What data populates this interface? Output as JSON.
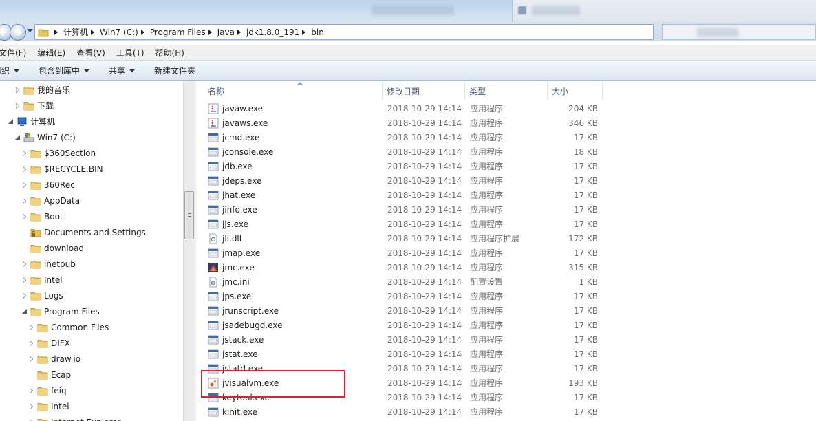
{
  "address": {
    "crumbs": [
      "计算机",
      "Win7 (C:)",
      "Program Files",
      "Java",
      "jdk1.8.0_191",
      "bin"
    ]
  },
  "menu": [
    "文件(F)",
    "编辑(E)",
    "查看(V)",
    "工具(T)",
    "帮助(H)"
  ],
  "commands": {
    "organize": "组织",
    "include_library": "包含到库中",
    "share": "共享",
    "new_folder": "新建文件夹"
  },
  "tree": [
    {
      "label": "我的音乐",
      "indent": 0,
      "icon": "music-folder-icon",
      "toggle": "collapsed"
    },
    {
      "label": "下载",
      "indent": 0,
      "icon": "download-folder-icon",
      "toggle": "collapsed"
    },
    {
      "label": "计算机",
      "indent": -1,
      "icon": "computer-icon",
      "toggle": "expanded"
    },
    {
      "label": "Win7 (C:)",
      "indent": 0,
      "icon": "drive-icon",
      "toggle": "expanded"
    },
    {
      "label": "$360Section",
      "indent": 1,
      "icon": "folder-icon",
      "toggle": "collapsed"
    },
    {
      "label": "$RECYCLE.BIN",
      "indent": 1,
      "icon": "folder-icon",
      "toggle": "collapsed"
    },
    {
      "label": "360Rec",
      "indent": 1,
      "icon": "folder-icon",
      "toggle": "collapsed"
    },
    {
      "label": "AppData",
      "indent": 1,
      "icon": "folder-icon",
      "toggle": "collapsed"
    },
    {
      "label": "Boot",
      "indent": 1,
      "icon": "folder-icon",
      "toggle": "collapsed"
    },
    {
      "label": "Documents and Settings",
      "indent": 1,
      "icon": "locked-folder-icon",
      "toggle": "none"
    },
    {
      "label": "download",
      "indent": 1,
      "icon": "folder-icon",
      "toggle": "none"
    },
    {
      "label": "inetpub",
      "indent": 1,
      "icon": "folder-icon",
      "toggle": "collapsed"
    },
    {
      "label": "Intel",
      "indent": 1,
      "icon": "folder-icon",
      "toggle": "collapsed"
    },
    {
      "label": "Logs",
      "indent": 1,
      "icon": "folder-icon",
      "toggle": "collapsed"
    },
    {
      "label": "Program Files",
      "indent": 1,
      "icon": "folder-icon",
      "toggle": "expanded"
    },
    {
      "label": "Common Files",
      "indent": 2,
      "icon": "folder-icon",
      "toggle": "collapsed"
    },
    {
      "label": "DIFX",
      "indent": 2,
      "icon": "folder-icon",
      "toggle": "collapsed"
    },
    {
      "label": "draw.io",
      "indent": 2,
      "icon": "folder-icon",
      "toggle": "collapsed"
    },
    {
      "label": "Ecap",
      "indent": 2,
      "icon": "folder-icon",
      "toggle": "none"
    },
    {
      "label": "feiq",
      "indent": 2,
      "icon": "folder-icon",
      "toggle": "collapsed"
    },
    {
      "label": "Intel",
      "indent": 2,
      "icon": "folder-icon",
      "toggle": "collapsed"
    },
    {
      "label": "Internet Explorer",
      "indent": 2,
      "icon": "folder-icon",
      "toggle": "collapsed"
    }
  ],
  "columns": {
    "name": "名称",
    "date": "修改日期",
    "type": "类型",
    "size": "大小"
  },
  "files": [
    {
      "name": "javaw.exe",
      "date": "2018-10-29 14:14",
      "type": "应用程序",
      "size": "204 KB",
      "icon": "java-exe-icon"
    },
    {
      "name": "javaws.exe",
      "date": "2018-10-29 14:14",
      "type": "应用程序",
      "size": "346 KB",
      "icon": "java-exe-icon"
    },
    {
      "name": "jcmd.exe",
      "date": "2018-10-29 14:14",
      "type": "应用程序",
      "size": "17 KB",
      "icon": "exe-icon"
    },
    {
      "name": "jconsole.exe",
      "date": "2018-10-29 14:14",
      "type": "应用程序",
      "size": "18 KB",
      "icon": "exe-icon"
    },
    {
      "name": "jdb.exe",
      "date": "2018-10-29 14:14",
      "type": "应用程序",
      "size": "17 KB",
      "icon": "exe-icon"
    },
    {
      "name": "jdeps.exe",
      "date": "2018-10-29 14:14",
      "type": "应用程序",
      "size": "17 KB",
      "icon": "exe-icon"
    },
    {
      "name": "jhat.exe",
      "date": "2018-10-29 14:14",
      "type": "应用程序",
      "size": "17 KB",
      "icon": "exe-icon"
    },
    {
      "name": "jinfo.exe",
      "date": "2018-10-29 14:14",
      "type": "应用程序",
      "size": "17 KB",
      "icon": "exe-icon"
    },
    {
      "name": "jjs.exe",
      "date": "2018-10-29 14:14",
      "type": "应用程序",
      "size": "17 KB",
      "icon": "exe-icon"
    },
    {
      "name": "jli.dll",
      "date": "2018-10-29 14:14",
      "type": "应用程序扩展",
      "size": "172 KB",
      "icon": "dll-icon"
    },
    {
      "name": "jmap.exe",
      "date": "2018-10-29 14:14",
      "type": "应用程序",
      "size": "17 KB",
      "icon": "exe-icon"
    },
    {
      "name": "jmc.exe",
      "date": "2018-10-29 14:14",
      "type": "应用程序",
      "size": "315 KB",
      "icon": "jmc-icon"
    },
    {
      "name": "jmc.ini",
      "date": "2018-10-29 14:14",
      "type": "配置设置",
      "size": "1 KB",
      "icon": "ini-icon"
    },
    {
      "name": "jps.exe",
      "date": "2018-10-29 14:14",
      "type": "应用程序",
      "size": "17 KB",
      "icon": "exe-icon"
    },
    {
      "name": "jrunscript.exe",
      "date": "2018-10-29 14:14",
      "type": "应用程序",
      "size": "17 KB",
      "icon": "exe-icon"
    },
    {
      "name": "jsadebugd.exe",
      "date": "2018-10-29 14:14",
      "type": "应用程序",
      "size": "17 KB",
      "icon": "exe-icon"
    },
    {
      "name": "jstack.exe",
      "date": "2018-10-29 14:14",
      "type": "应用程序",
      "size": "17 KB",
      "icon": "exe-icon"
    },
    {
      "name": "jstat.exe",
      "date": "2018-10-29 14:14",
      "type": "应用程序",
      "size": "17 KB",
      "icon": "exe-icon"
    },
    {
      "name": "jstatd.exe",
      "date": "2018-10-29 14:14",
      "type": "应用程序",
      "size": "17 KB",
      "icon": "exe-icon"
    },
    {
      "name": "jvisualvm.exe",
      "date": "2018-10-29 14:14",
      "type": "应用程序",
      "size": "193 KB",
      "icon": "visualvm-icon"
    },
    {
      "name": "keytool.exe",
      "date": "2018-10-29 14:14",
      "type": "应用程序",
      "size": "17 KB",
      "icon": "exe-icon"
    },
    {
      "name": "kinit.exe",
      "date": "2018-10-29 14:14",
      "type": "应用程序",
      "size": "17 KB",
      "icon": "exe-icon"
    }
  ],
  "colors": {
    "highlight": "#e0202d",
    "header_text": "#4d5e75",
    "folder": "#e8c25a"
  }
}
